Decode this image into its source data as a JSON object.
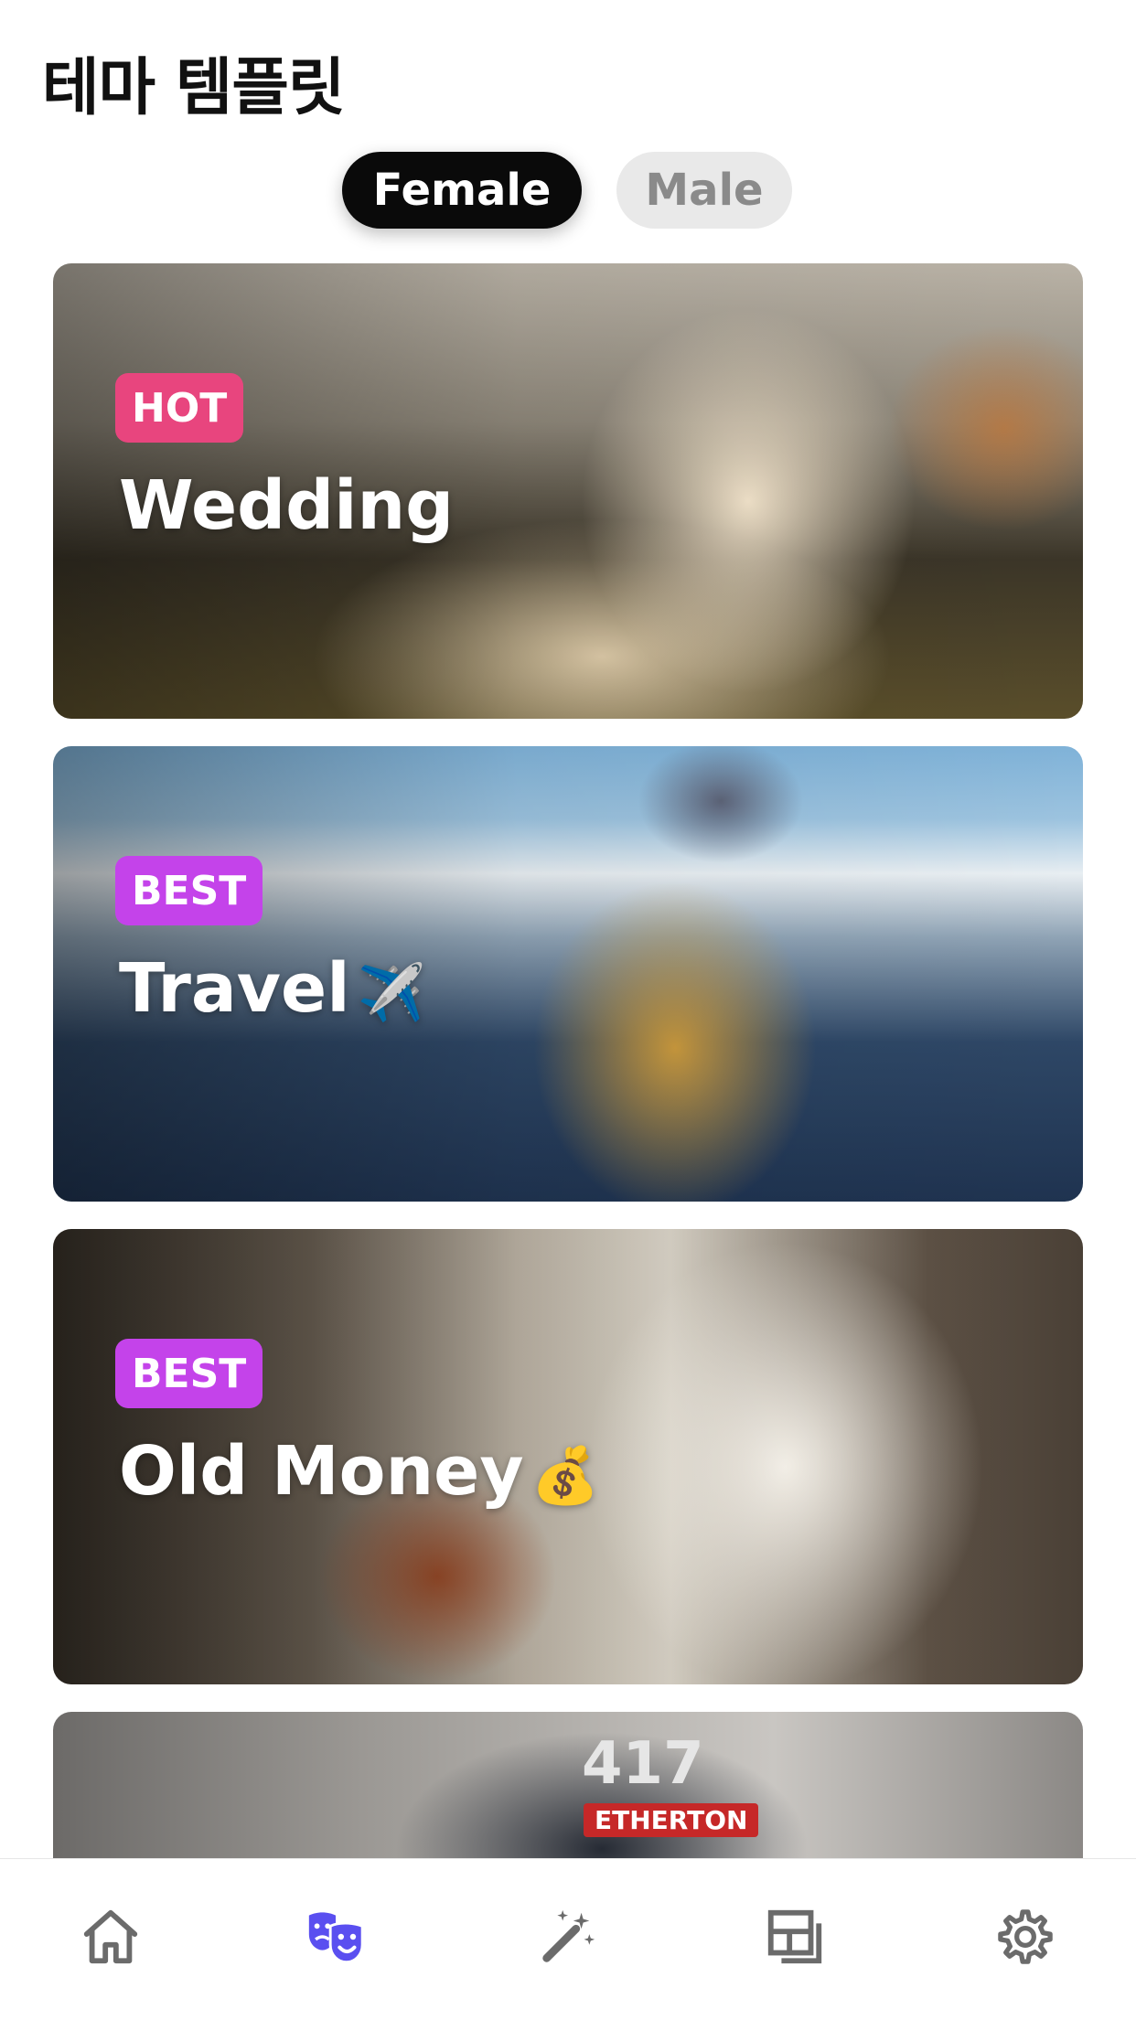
{
  "page": {
    "title": "테마 템플릿"
  },
  "gender_toggle": {
    "options": [
      {
        "label": "Female",
        "selected": true
      },
      {
        "label": "Male",
        "selected": false
      }
    ]
  },
  "templates": [
    {
      "badge": "HOT",
      "badge_color": "#e8457e",
      "title": "Wedding",
      "emoji": ""
    },
    {
      "badge": "BEST",
      "badge_color": "#c443ea",
      "title": "Travel",
      "emoji": "✈️"
    },
    {
      "badge": "BEST",
      "badge_color": "#c443ea",
      "title": "Old Money",
      "emoji": "💰"
    },
    {
      "helmet_number": "417",
      "helmet_label": "ETHERTON"
    }
  ],
  "bottom_nav": {
    "active_color": "#5a4ff0",
    "inactive_color": "#6b6b6b",
    "items": [
      {
        "icon": "home-icon",
        "active": false
      },
      {
        "icon": "theater-masks-icon",
        "active": true
      },
      {
        "icon": "magic-wand-icon",
        "active": false
      },
      {
        "icon": "layout-icon",
        "active": false
      },
      {
        "icon": "gear-icon",
        "active": false
      }
    ]
  }
}
